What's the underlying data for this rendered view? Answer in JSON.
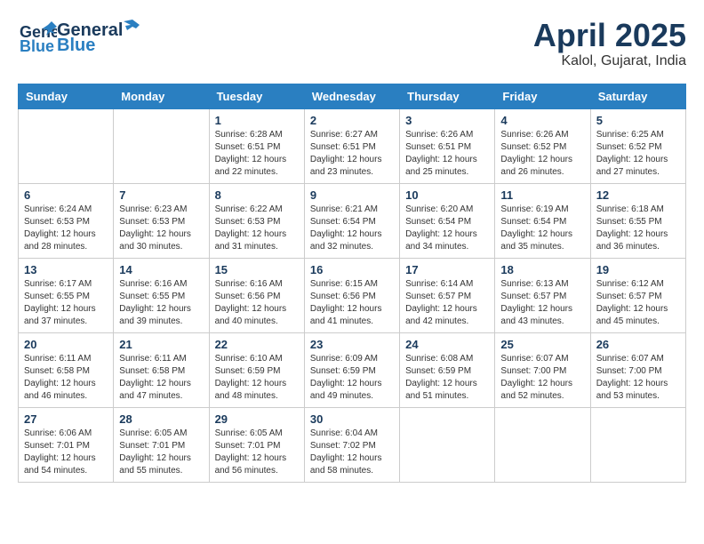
{
  "header": {
    "logo_line1": "General",
    "logo_line2": "Blue",
    "title": "April 2025",
    "subtitle": "Kalol, Gujarat, India"
  },
  "weekdays": [
    "Sunday",
    "Monday",
    "Tuesday",
    "Wednesday",
    "Thursday",
    "Friday",
    "Saturday"
  ],
  "weeks": [
    [
      {
        "day": "",
        "info": ""
      },
      {
        "day": "",
        "info": ""
      },
      {
        "day": "1",
        "info": "Sunrise: 6:28 AM\nSunset: 6:51 PM\nDaylight: 12 hours\nand 22 minutes."
      },
      {
        "day": "2",
        "info": "Sunrise: 6:27 AM\nSunset: 6:51 PM\nDaylight: 12 hours\nand 23 minutes."
      },
      {
        "day": "3",
        "info": "Sunrise: 6:26 AM\nSunset: 6:51 PM\nDaylight: 12 hours\nand 25 minutes."
      },
      {
        "day": "4",
        "info": "Sunrise: 6:26 AM\nSunset: 6:52 PM\nDaylight: 12 hours\nand 26 minutes."
      },
      {
        "day": "5",
        "info": "Sunrise: 6:25 AM\nSunset: 6:52 PM\nDaylight: 12 hours\nand 27 minutes."
      }
    ],
    [
      {
        "day": "6",
        "info": "Sunrise: 6:24 AM\nSunset: 6:53 PM\nDaylight: 12 hours\nand 28 minutes."
      },
      {
        "day": "7",
        "info": "Sunrise: 6:23 AM\nSunset: 6:53 PM\nDaylight: 12 hours\nand 30 minutes."
      },
      {
        "day": "8",
        "info": "Sunrise: 6:22 AM\nSunset: 6:53 PM\nDaylight: 12 hours\nand 31 minutes."
      },
      {
        "day": "9",
        "info": "Sunrise: 6:21 AM\nSunset: 6:54 PM\nDaylight: 12 hours\nand 32 minutes."
      },
      {
        "day": "10",
        "info": "Sunrise: 6:20 AM\nSunset: 6:54 PM\nDaylight: 12 hours\nand 34 minutes."
      },
      {
        "day": "11",
        "info": "Sunrise: 6:19 AM\nSunset: 6:54 PM\nDaylight: 12 hours\nand 35 minutes."
      },
      {
        "day": "12",
        "info": "Sunrise: 6:18 AM\nSunset: 6:55 PM\nDaylight: 12 hours\nand 36 minutes."
      }
    ],
    [
      {
        "day": "13",
        "info": "Sunrise: 6:17 AM\nSunset: 6:55 PM\nDaylight: 12 hours\nand 37 minutes."
      },
      {
        "day": "14",
        "info": "Sunrise: 6:16 AM\nSunset: 6:55 PM\nDaylight: 12 hours\nand 39 minutes."
      },
      {
        "day": "15",
        "info": "Sunrise: 6:16 AM\nSunset: 6:56 PM\nDaylight: 12 hours\nand 40 minutes."
      },
      {
        "day": "16",
        "info": "Sunrise: 6:15 AM\nSunset: 6:56 PM\nDaylight: 12 hours\nand 41 minutes."
      },
      {
        "day": "17",
        "info": "Sunrise: 6:14 AM\nSunset: 6:57 PM\nDaylight: 12 hours\nand 42 minutes."
      },
      {
        "day": "18",
        "info": "Sunrise: 6:13 AM\nSunset: 6:57 PM\nDaylight: 12 hours\nand 43 minutes."
      },
      {
        "day": "19",
        "info": "Sunrise: 6:12 AM\nSunset: 6:57 PM\nDaylight: 12 hours\nand 45 minutes."
      }
    ],
    [
      {
        "day": "20",
        "info": "Sunrise: 6:11 AM\nSunset: 6:58 PM\nDaylight: 12 hours\nand 46 minutes."
      },
      {
        "day": "21",
        "info": "Sunrise: 6:11 AM\nSunset: 6:58 PM\nDaylight: 12 hours\nand 47 minutes."
      },
      {
        "day": "22",
        "info": "Sunrise: 6:10 AM\nSunset: 6:59 PM\nDaylight: 12 hours\nand 48 minutes."
      },
      {
        "day": "23",
        "info": "Sunrise: 6:09 AM\nSunset: 6:59 PM\nDaylight: 12 hours\nand 49 minutes."
      },
      {
        "day": "24",
        "info": "Sunrise: 6:08 AM\nSunset: 6:59 PM\nDaylight: 12 hours\nand 51 minutes."
      },
      {
        "day": "25",
        "info": "Sunrise: 6:07 AM\nSunset: 7:00 PM\nDaylight: 12 hours\nand 52 minutes."
      },
      {
        "day": "26",
        "info": "Sunrise: 6:07 AM\nSunset: 7:00 PM\nDaylight: 12 hours\nand 53 minutes."
      }
    ],
    [
      {
        "day": "27",
        "info": "Sunrise: 6:06 AM\nSunset: 7:01 PM\nDaylight: 12 hours\nand 54 minutes."
      },
      {
        "day": "28",
        "info": "Sunrise: 6:05 AM\nSunset: 7:01 PM\nDaylight: 12 hours\nand 55 minutes."
      },
      {
        "day": "29",
        "info": "Sunrise: 6:05 AM\nSunset: 7:01 PM\nDaylight: 12 hours\nand 56 minutes."
      },
      {
        "day": "30",
        "info": "Sunrise: 6:04 AM\nSunset: 7:02 PM\nDaylight: 12 hours\nand 58 minutes."
      },
      {
        "day": "",
        "info": ""
      },
      {
        "day": "",
        "info": ""
      },
      {
        "day": "",
        "info": ""
      }
    ]
  ]
}
